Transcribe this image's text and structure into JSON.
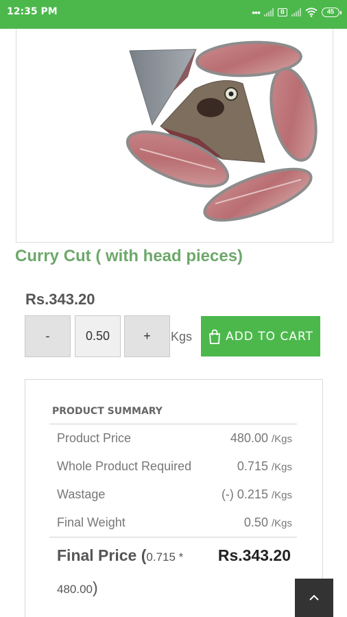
{
  "status_bar": {
    "time": "12:35 PM",
    "sim_label": "B",
    "battery": "45"
  },
  "product": {
    "title": "Curry Cut ( with head pieces)",
    "price": "Rs.343.20",
    "quantity": "0.50",
    "unit": "Kgs",
    "decrement_label": "-",
    "increment_label": "+",
    "add_to_cart_label": "ADD TO CART"
  },
  "summary": {
    "heading": "PRODUCT SUMMARY",
    "rows": [
      {
        "label": "Product Price",
        "value": "480.00",
        "unit": "/Kgs"
      },
      {
        "label": "Whole Product Required",
        "value": "0.715",
        "unit": "/Kgs"
      },
      {
        "label": "Wastage",
        "value": "(-) 0.215",
        "unit": "/Kgs"
      },
      {
        "label": "Final Weight",
        "value": "0.50",
        "unit": "/Kgs"
      }
    ],
    "final_label": "Final Price",
    "final_calc_open": "(",
    "final_calc_part1": "0.715 *",
    "final_calc_part2": "480.00",
    "final_calc_close": ")",
    "final_value": "Rs.343.20"
  },
  "icons": {
    "cart": "shopping-bag-icon",
    "scroll_top": "chevron-up-icon",
    "wifi": "wifi-icon",
    "battery": "battery-icon"
  },
  "colors": {
    "brand_green": "#4cb84c",
    "title_green": "#6da86a",
    "scroll_button": "#333333"
  }
}
